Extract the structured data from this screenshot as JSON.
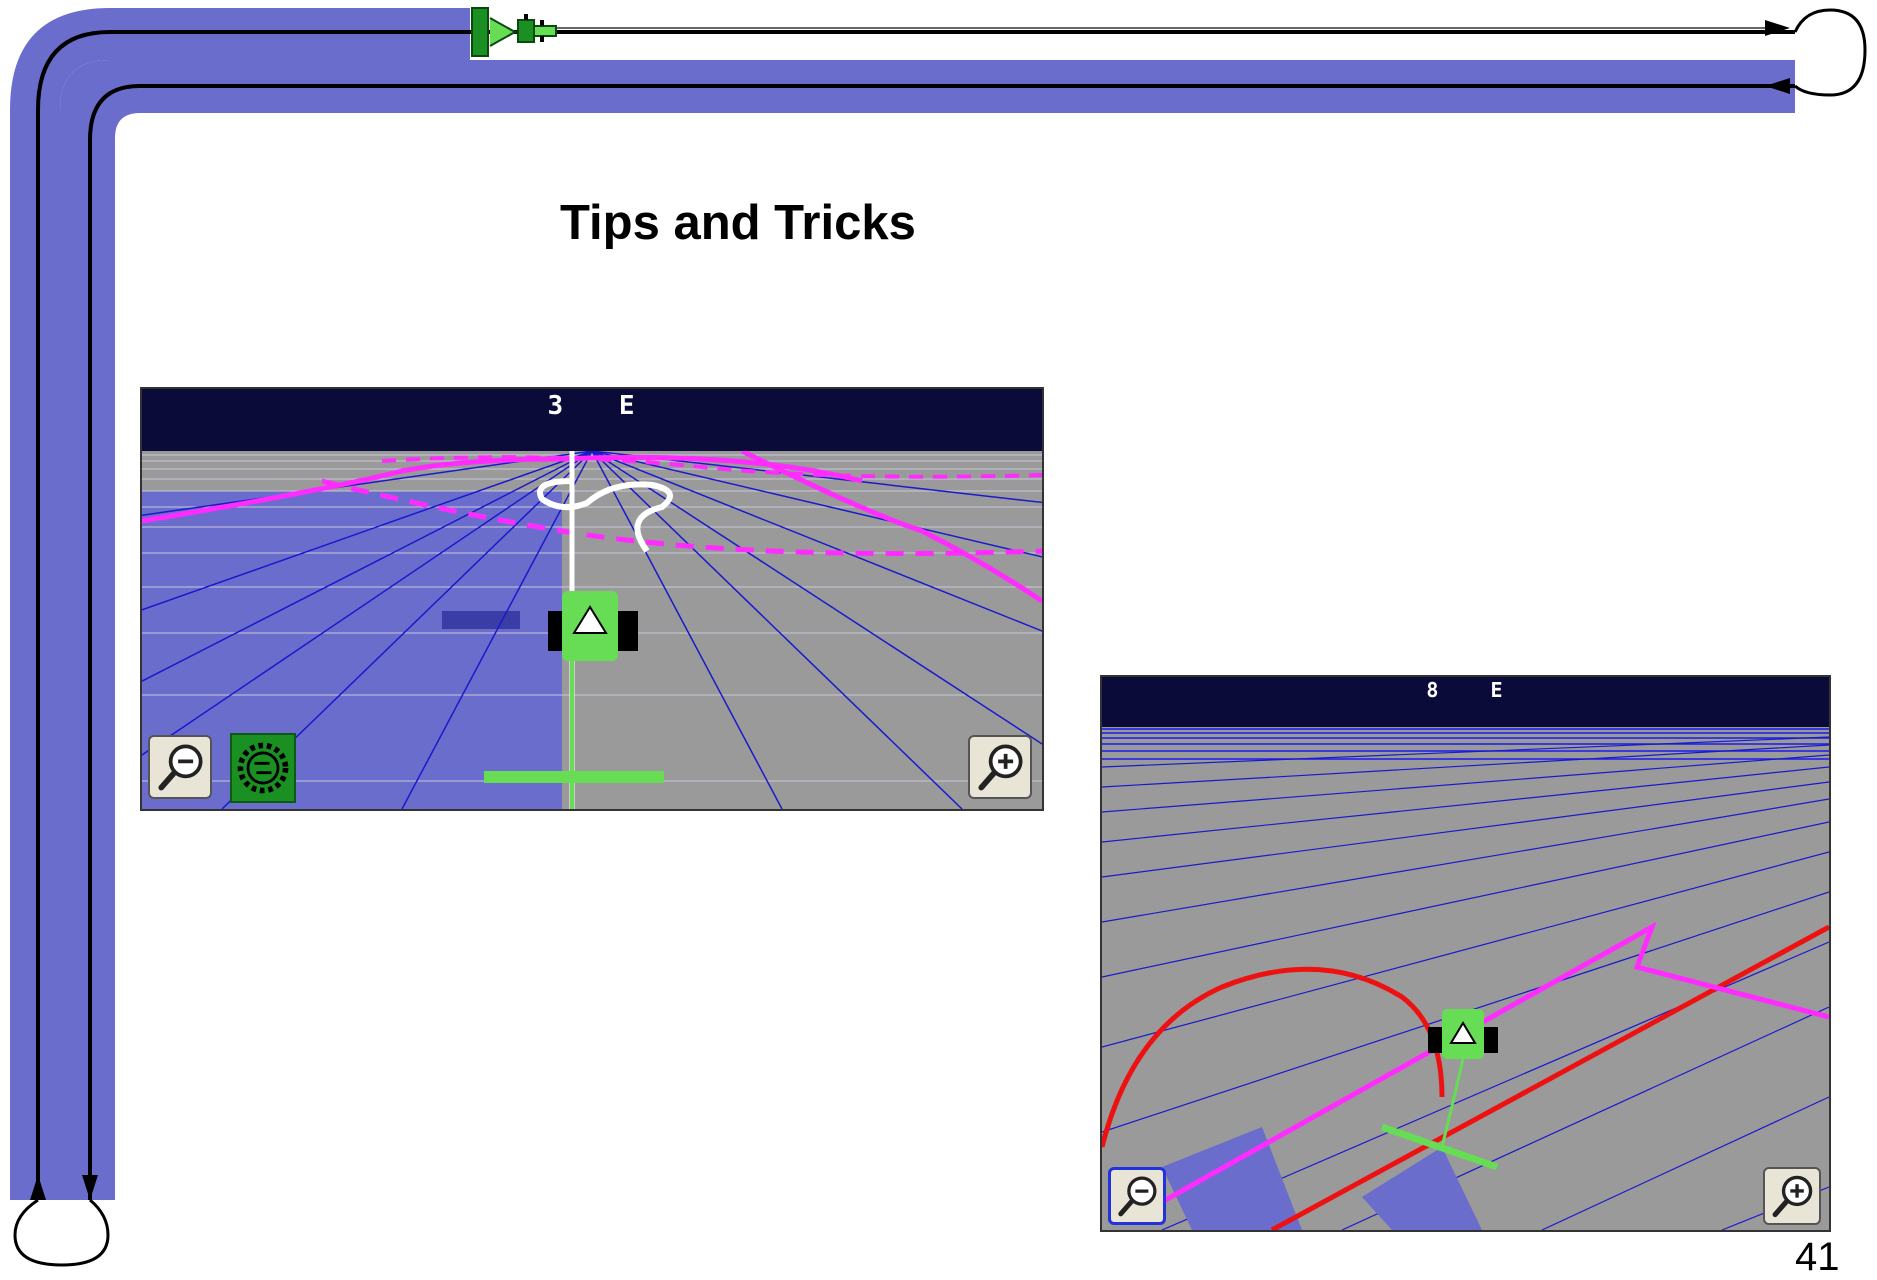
{
  "slide": {
    "title": "Tips and Tricks",
    "page_number": "41"
  },
  "screens": [
    {
      "status": {
        "value": "3",
        "direction": "E"
      },
      "buttons": {
        "zoom_out": "zoom-out-magnifier-icon",
        "steering": "steering-gear-icon",
        "zoom_in": "zoom-in-magnifier-icon"
      }
    },
    {
      "status": {
        "value": "8",
        "direction": "E"
      },
      "buttons": {
        "zoom_out": "zoom-out-magnifier-icon",
        "zoom_in": "zoom-in-magnifier-icon"
      }
    }
  ],
  "colors": {
    "frame_band": "#6b6dcc",
    "screen_sky": "#0b0b3a",
    "ground": "#9a9a9a",
    "coverage": "#6b6dcc",
    "guidance_magenta": "#ff2bff",
    "boundary_red": "#ee1111",
    "vehicle_green": "#66dd55",
    "steering_green": "#1a8f22"
  }
}
